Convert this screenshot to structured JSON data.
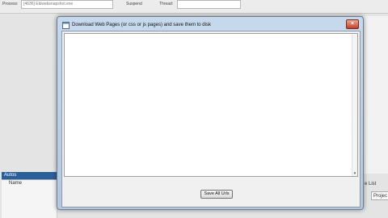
{
  "dialog": {
    "title": "Download Web Pages (or css or js pages) and save them to disk",
    "close_glyph": "×",
    "save_button_label": "Save All Urls"
  },
  "background": {
    "toolbar": {
      "process_label": "Process:",
      "process_value": "[4636] Ekiwebsnapshot.exe",
      "suspend_label": "Suspend",
      "thread_label": "Thread:"
    },
    "sidebar": {
      "selected_item": "Autos",
      "column_header": "Name"
    },
    "right_panel": {
      "label": "e List",
      "button_label": "Projec"
    }
  },
  "icons": [
    "app-window-icon",
    "close-icon",
    "scroll-down-icon"
  ]
}
